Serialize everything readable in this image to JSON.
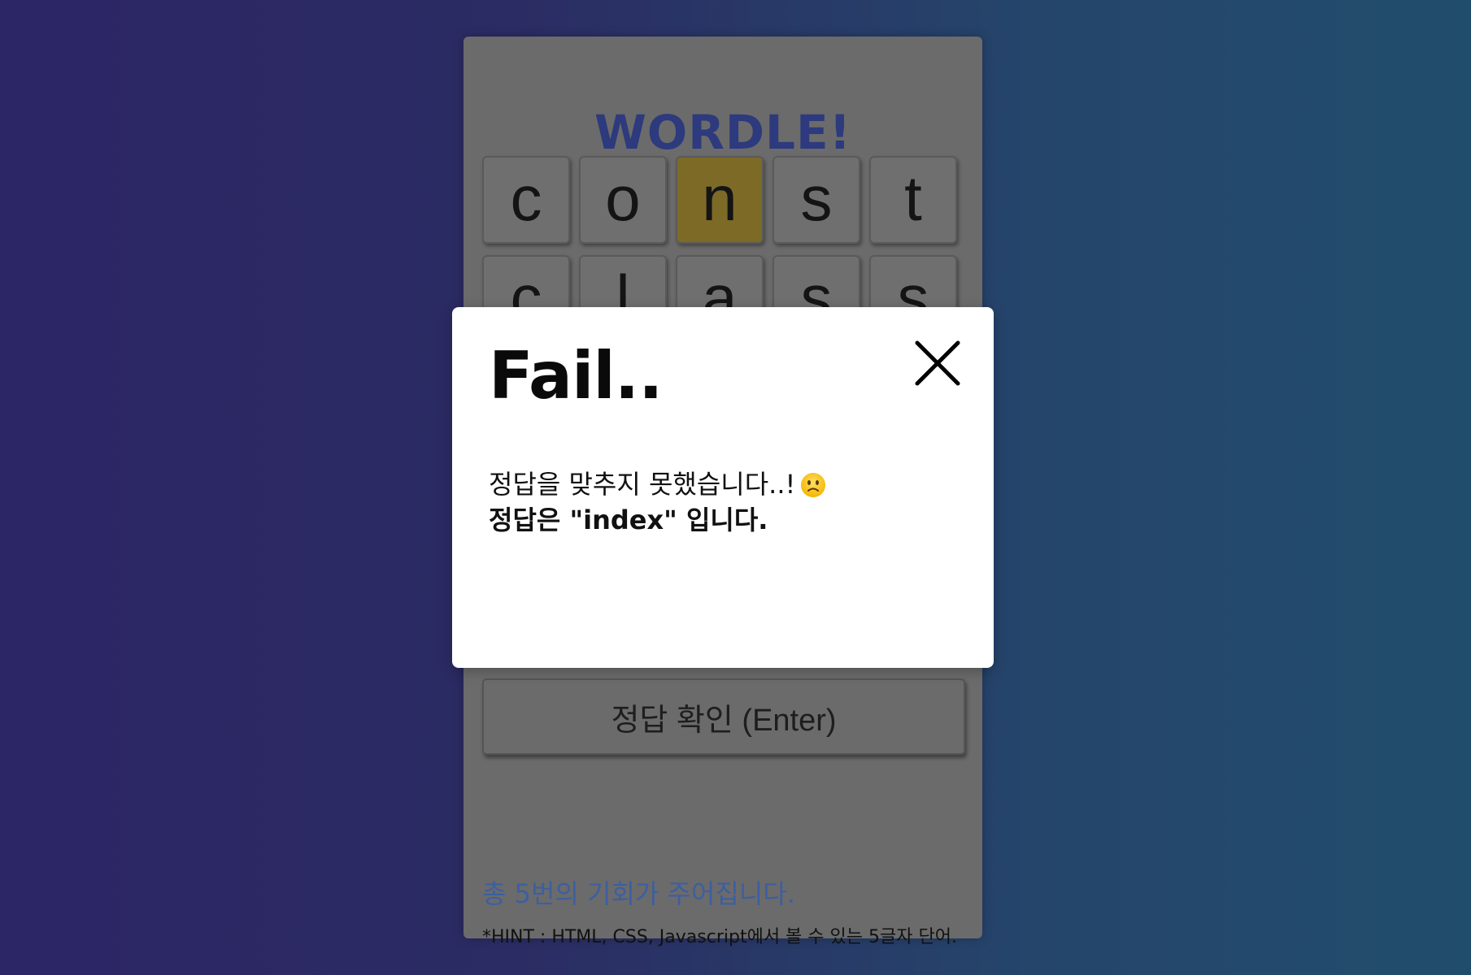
{
  "app": {
    "title": "WORDLE!"
  },
  "board": {
    "rows": [
      [
        {
          "letter": "c",
          "state": "absent"
        },
        {
          "letter": "o",
          "state": "absent"
        },
        {
          "letter": "n",
          "state": "present"
        },
        {
          "letter": "s",
          "state": "absent"
        },
        {
          "letter": "t",
          "state": "absent"
        }
      ],
      [
        {
          "letter": "c",
          "state": "absent"
        },
        {
          "letter": "l",
          "state": "absent"
        },
        {
          "letter": "a",
          "state": "absent"
        },
        {
          "letter": "s",
          "state": "absent"
        },
        {
          "letter": "s",
          "state": "absent"
        }
      ]
    ]
  },
  "submit_button": {
    "label": "정답 확인 (Enter)"
  },
  "info": {
    "chances_text": "총 5번의 기회가 주어집니다.",
    "hint_text": "*HINT : HTML, CSS, Javascript에서 볼 수 있는 5글자 단어."
  },
  "modal": {
    "title": "Fail..",
    "message": "정답을 맞추지 못했습니다..!",
    "answer_text": "정답은 \"index\" 입니다.",
    "emoji_icon": "slightly-frowning-face-icon",
    "close_icon": "close-icon"
  },
  "colors": {
    "title": "#2d3a7d",
    "present_tile": "#7d6a26",
    "info_text": "#3c5fa0",
    "background_start": "#2c2566",
    "background_end": "#214d6c"
  }
}
